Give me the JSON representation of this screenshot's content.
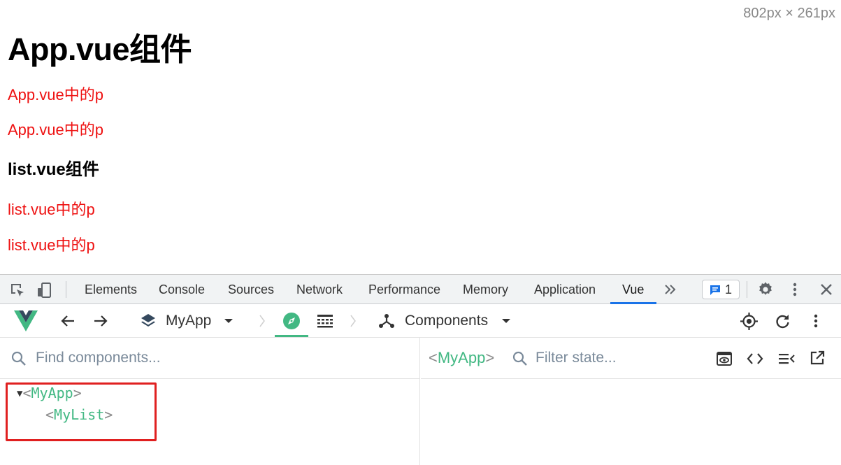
{
  "page": {
    "size_readout": "802px × 261px",
    "app_heading": "App.vue组件",
    "app_paragraphs": [
      "App.vue中的p",
      "App.vue中的p"
    ],
    "list_heading": "list.vue组件",
    "list_paragraphs": [
      "list.vue中的p",
      "list.vue中的p"
    ]
  },
  "devtools": {
    "tabs": [
      "Elements",
      "Console",
      "Sources",
      "Network",
      "Performance",
      "Memory",
      "Application",
      "Vue"
    ],
    "active_tab": "Vue",
    "issues_count": "1",
    "icons": [
      "inspect-element-icon",
      "device-toolbar-icon",
      "more-tabs-icon",
      "issues-icon",
      "settings-icon",
      "kebab-menu-icon",
      "close-icon"
    ]
  },
  "vue_toolbar": {
    "app_selector": "MyApp",
    "section_selector": "Components",
    "icons": [
      "vue-logo-icon",
      "back-arrow-icon",
      "forward-arrow-icon",
      "layers-icon",
      "compass-icon",
      "timeline-icon",
      "components-icon",
      "target-icon",
      "refresh-icon",
      "more-icon"
    ]
  },
  "components_panel": {
    "search_placeholder": "Find components...",
    "tree": [
      {
        "name": "MyApp",
        "expanded": true
      },
      {
        "name": "MyList"
      }
    ]
  },
  "state_panel": {
    "selected_component": "MyApp",
    "filter_placeholder": "Filter state..."
  },
  "colors": {
    "vue_green": "#42b883",
    "paragraph_red": "#ee1111",
    "highlight_red": "#e02020",
    "tab_underline_blue": "#1a73e8"
  }
}
